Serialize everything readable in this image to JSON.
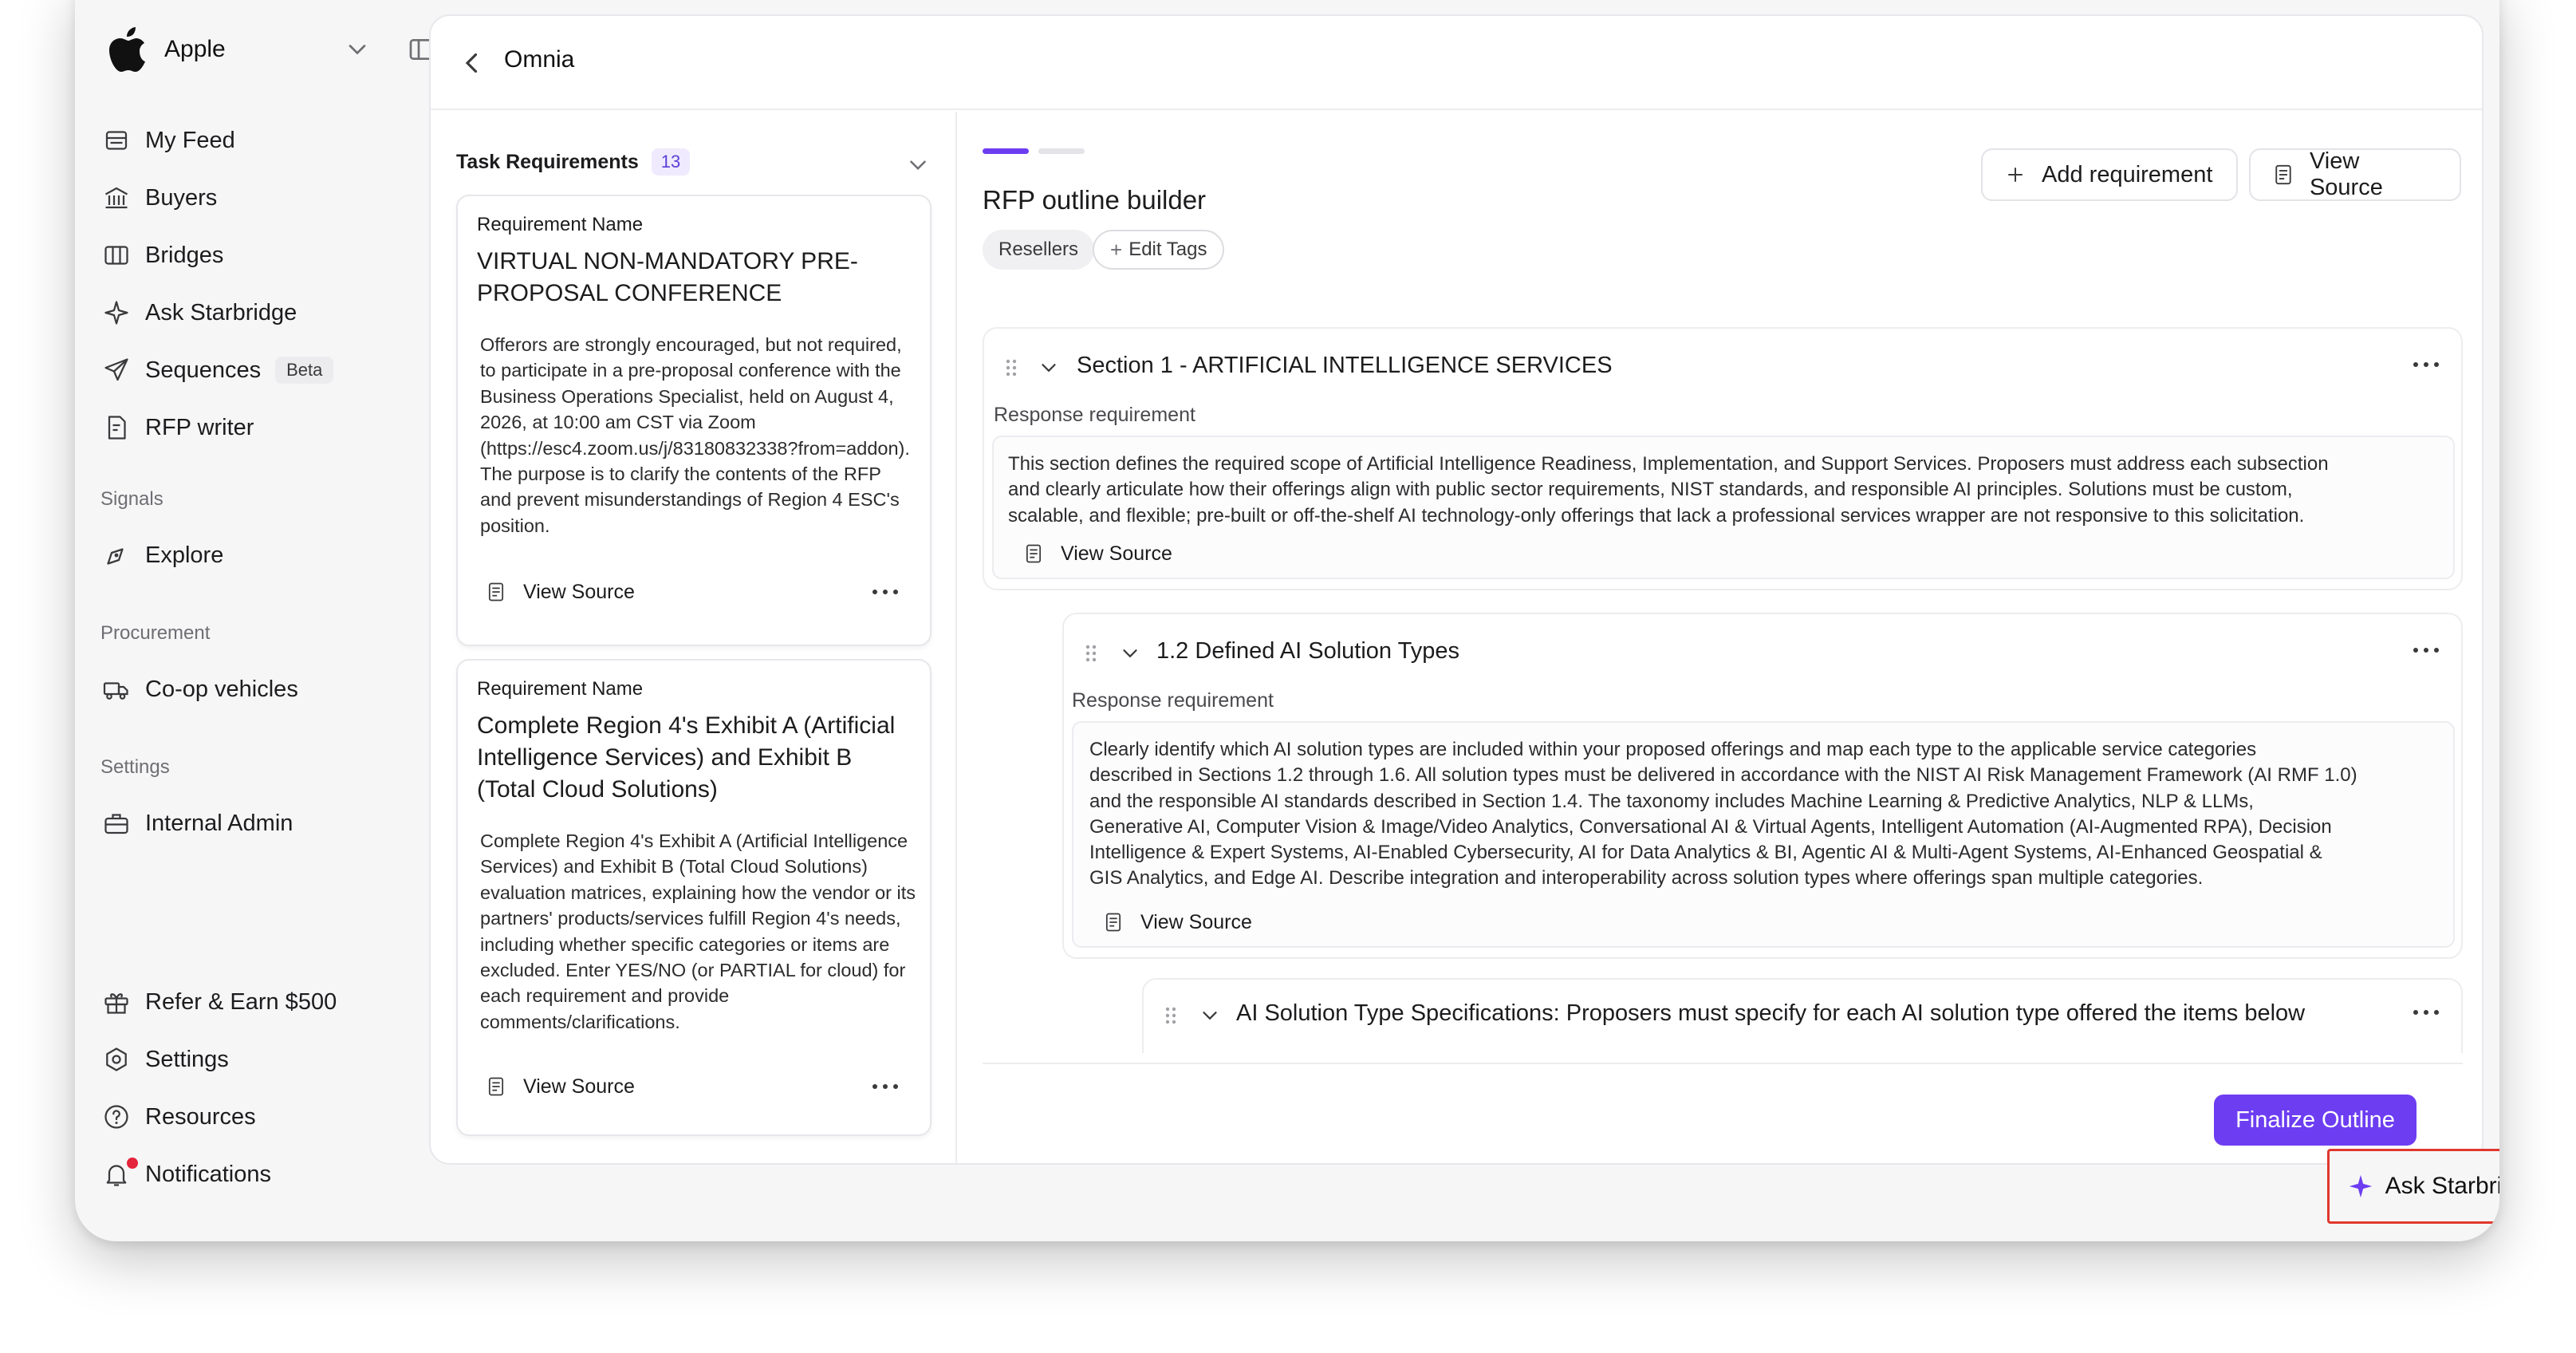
{
  "org": {
    "name": "Apple"
  },
  "nav": {
    "main": [
      {
        "label": "My Feed"
      },
      {
        "label": "Buyers"
      },
      {
        "label": "Bridges"
      },
      {
        "label": "Ask Starbridge"
      },
      {
        "label": "Sequences",
        "badge": "Beta"
      },
      {
        "label": "RFP writer"
      }
    ],
    "signals_label": "Signals",
    "signals": [
      {
        "label": "Explore"
      }
    ],
    "procurement_label": "Procurement",
    "procurement": [
      {
        "label": "Co-op vehicles"
      }
    ],
    "settings_label": "Settings",
    "settings": [
      {
        "label": "Internal Admin"
      }
    ],
    "bottom": [
      {
        "label": "Refer & Earn $500"
      },
      {
        "label": "Settings"
      },
      {
        "label": "Resources"
      },
      {
        "label": "Notifications"
      }
    ]
  },
  "header": {
    "title": "Omnia"
  },
  "requirements": {
    "title": "Task Requirements",
    "count": "13",
    "cards": [
      {
        "caption": "Requirement Name",
        "name": "VIRTUAL NON-MANDATORY PRE-PROPOSAL CONFERENCE",
        "body": "Offerors are strongly encouraged, but not required, to participate in a pre-proposal conference with the Business Operations Specialist, held on August 4, 2026, at 10:00 am CST via Zoom (https://esc4.zoom.us/j/83180832338?from=addon). The purpose is to clarify the contents of the RFP and prevent misunderstandings of Region 4 ESC's position.",
        "view_source": "View Source"
      },
      {
        "caption": "Requirement Name",
        "name": "Complete Region 4's Exhibit A (Artificial Intelligence Services) and Exhibit B (Total Cloud Solutions)",
        "body": "Complete Region 4's Exhibit A (Artificial Intelligence Services) and Exhibit B (Total Cloud Solutions) evaluation matrices, explaining how the vendor or its partners' products/services fulfill Region 4's needs, including whether specific categories or items are excluded. Enter YES/NO (or PARTIAL for cloud) for each requirement and provide comments/clarifications.",
        "view_source": "View Source"
      }
    ]
  },
  "builder": {
    "title": "RFP outline builder",
    "progress": {
      "current_step": 1,
      "total_steps": 2
    },
    "tags": [
      "Resellers"
    ],
    "edit_tags": "Edit Tags",
    "add_requirement": "Add requirement",
    "view_source": "View Source",
    "finalize": "Finalize Outline",
    "sections": [
      {
        "title": "Section 1 - ARTIFICIAL INTELLIGENCE SERVICES",
        "response_label": "Response requirement",
        "lines": [
          "This section defines the required scope of Artificial Intelligence Readiness, Implementation, and Support Services. Proposers must address each subsection",
          "and clearly articulate how their offerings align with public sector requirements, NIST standards, and responsible AI principles. Solutions must be custom,",
          "scalable, and flexible; pre-built or off-the-shelf AI technology-only offerings that lack a professional services wrapper are not responsive to this solicitation."
        ],
        "view_source": "View Source"
      },
      {
        "title": "1.2 Defined AI Solution Types",
        "response_label": "Response requirement",
        "lines": [
          "Clearly identify which AI solution types are included within your proposed offerings and map each type to the applicable service categories",
          "described in Sections 1.2 through 1.6. All solution types must be delivered in accordance with the NIST AI Risk Management Framework (AI RMF 1.0)",
          "and the responsible AI standards described in Section 1.4. The taxonomy includes Machine Learning & Predictive Analytics, NLP & LLMs,",
          "Generative AI, Computer Vision & Image/Video Analytics, Conversational AI & Virtual Agents, Intelligent Automation (AI-Augmented RPA), Decision",
          "Intelligence & Expert Systems, AI-Enabled Cybersecurity, AI for Data Analytics & BI, Agentic AI & Multi-Agent Systems, AI-Enhanced Geospatial &",
          "GIS Analytics, and Edge AI. Describe integration and interoperability across solution types where offerings span multiple categories."
        ],
        "view_source": "View Source"
      },
      {
        "title": "AI Solution Type Specifications: Proposers must specify for each AI solution type offered the items below"
      }
    ]
  },
  "ask_button": {
    "label": "Ask Starbridge"
  },
  "colors": {
    "accent": "#6d3df2",
    "highlight": "#e0382e"
  }
}
